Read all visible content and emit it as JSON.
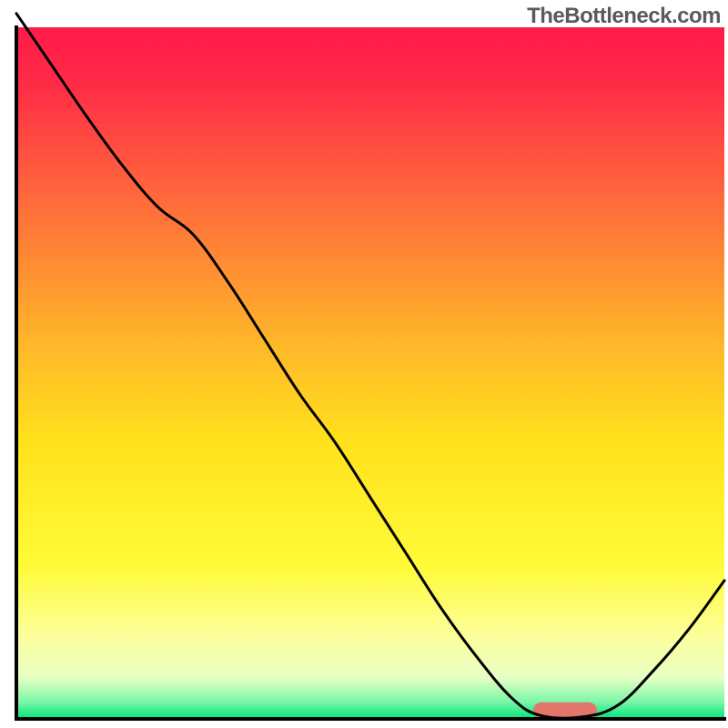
{
  "watermark": "TheBottleneck.com",
  "chart_data": {
    "type": "line",
    "title": "",
    "xlabel": "",
    "ylabel": "",
    "xlim": [
      0,
      100
    ],
    "ylim": [
      0,
      100
    ],
    "grid": false,
    "legend": false,
    "background_gradient": {
      "stops": [
        {
          "offset": 0.0,
          "color": "#ff1a49"
        },
        {
          "offset": 0.08,
          "color": "#ff2b47"
        },
        {
          "offset": 0.25,
          "color": "#ff6a3b"
        },
        {
          "offset": 0.45,
          "color": "#ffb42a"
        },
        {
          "offset": 0.6,
          "color": "#ffe21c"
        },
        {
          "offset": 0.78,
          "color": "#fffb38"
        },
        {
          "offset": 0.88,
          "color": "#fdff9c"
        },
        {
          "offset": 0.94,
          "color": "#e8ffc4"
        },
        {
          "offset": 0.975,
          "color": "#7cf7a8"
        },
        {
          "offset": 1.0,
          "color": "#00e47a"
        }
      ]
    },
    "series": [
      {
        "name": "bottleneck-curve",
        "color": "#000000",
        "width": 3,
        "x": [
          0,
          4,
          10,
          15,
          20,
          25,
          30,
          35,
          40,
          45,
          50,
          55,
          60,
          65,
          70,
          74,
          80,
          85,
          90,
          95,
          100
        ],
        "y": [
          102,
          96,
          87,
          80,
          74,
          70,
          63,
          55,
          47,
          40,
          32,
          24,
          16,
          9,
          3,
          0.5,
          0.3,
          2,
          7,
          13,
          20
        ]
      }
    ],
    "marker": {
      "name": "optimal-range",
      "color": "#e2766a",
      "x_start": 73,
      "x_end": 82,
      "y": 1.2,
      "thickness": 2.4
    },
    "axes": {
      "color": "#000000",
      "width": 4
    }
  }
}
